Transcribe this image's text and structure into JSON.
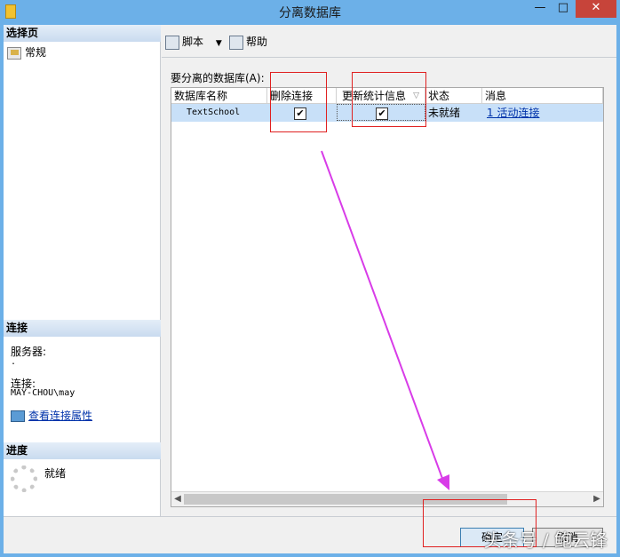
{
  "window": {
    "title": "分离数据库",
    "min_glyph": "—",
    "max_glyph": "□",
    "close_glyph": "✕"
  },
  "left": {
    "select_page_header": "选择页",
    "nav_general": "常规",
    "connection_header": "连接",
    "server_label": "服务器:",
    "server_value": ".",
    "connection_label": "连接:",
    "connection_value": "MAY-CHOU\\may",
    "view_props_link": "查看连接属性",
    "progress_header": "进度",
    "progress_status": "就绪"
  },
  "toolbar": {
    "script_label": "脚本",
    "script_dropdown": "▼",
    "help_label": "帮助"
  },
  "main": {
    "grid_label": "要分离的数据库(A):",
    "columns": [
      "数据库名称",
      "删除连接",
      "更新统计信息",
      "状态",
      "消息"
    ],
    "rows": [
      {
        "name": "TextSchool",
        "drop_connections": true,
        "update_stats": true,
        "status": "未就绪",
        "message": "1 活动连接"
      }
    ]
  },
  "buttons": {
    "ok": "确定",
    "cancel": "取消"
  },
  "watermark": "头条号 / 鲍云锋",
  "colors": {
    "selection": "#c8e0f8",
    "annotation_red": "#e02020",
    "annotation_arrow": "#d83ce8",
    "title_bar": "#6cb0e8"
  },
  "icons": {
    "app": "app-icon",
    "general": "general-page-icon",
    "script": "script-icon",
    "help": "help-icon",
    "view_props": "connection-properties-icon",
    "spinner": "progress-spinner-icon",
    "sort": "sort-arrow-icon"
  }
}
